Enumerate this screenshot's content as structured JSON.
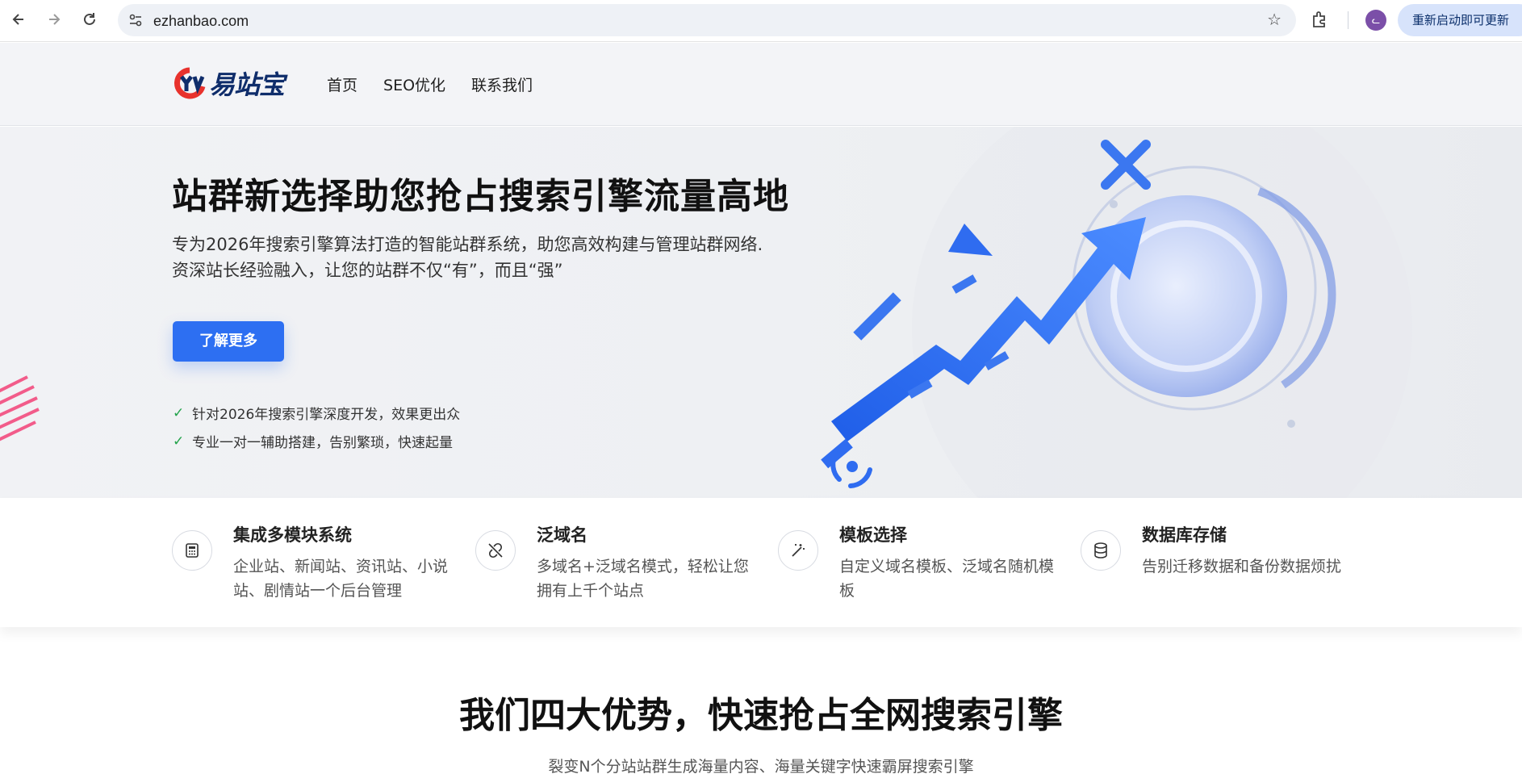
{
  "browser": {
    "url": "ezhanbao.com",
    "update_label": "重新启动即可更新",
    "profile_initial": "ᓚ"
  },
  "header": {
    "logo_text": "易站宝",
    "nav": [
      {
        "label": "首页"
      },
      {
        "label": "SEO优化"
      },
      {
        "label": "联系我们"
      }
    ]
  },
  "hero": {
    "title": "站群新选择助您抢占搜索引擎流量高地",
    "subtitle_line1": "专为2026年搜索引擎算法打造的智能站群系统，助您高效构建与管理站群网络.",
    "subtitle_line2": "资深站长经验融入，让您的站群不仅“有”，而且“强”",
    "cta_label": "了解更多",
    "checks": [
      {
        "text": "针对2026年搜索引擎深度开发，效果更出众"
      },
      {
        "text": "专业一对一辅助搭建，告别繁琐，快速起量"
      }
    ]
  },
  "features": [
    {
      "icon": "calculator-icon",
      "title": "集成多模块系统",
      "desc": "企业站、新闻站、资讯站、小说站、剧情站一个后台管理"
    },
    {
      "icon": "link-off-icon",
      "title": "泛域名",
      "desc": "多域名+泛域名模式，轻松让您拥有上千个站点"
    },
    {
      "icon": "magic-wand-icon",
      "title": "模板选择",
      "desc": "自定义域名模板、泛域名随机模板"
    },
    {
      "icon": "database-icon",
      "title": "数据库存储",
      "desc": "告别迁移数据和备份数据烦扰"
    }
  ],
  "section": {
    "title": "我们四大优势，快速抢占全网搜索引擎",
    "subtitle": "裂变N个分站站群生成海量内容、海量关键字快速霸屏搜索引擎"
  },
  "colors": {
    "accent": "#2d6ff2",
    "check": "#22a34a",
    "brand_dark": "#0f2d6b",
    "brand_red": "#e8322d"
  }
}
